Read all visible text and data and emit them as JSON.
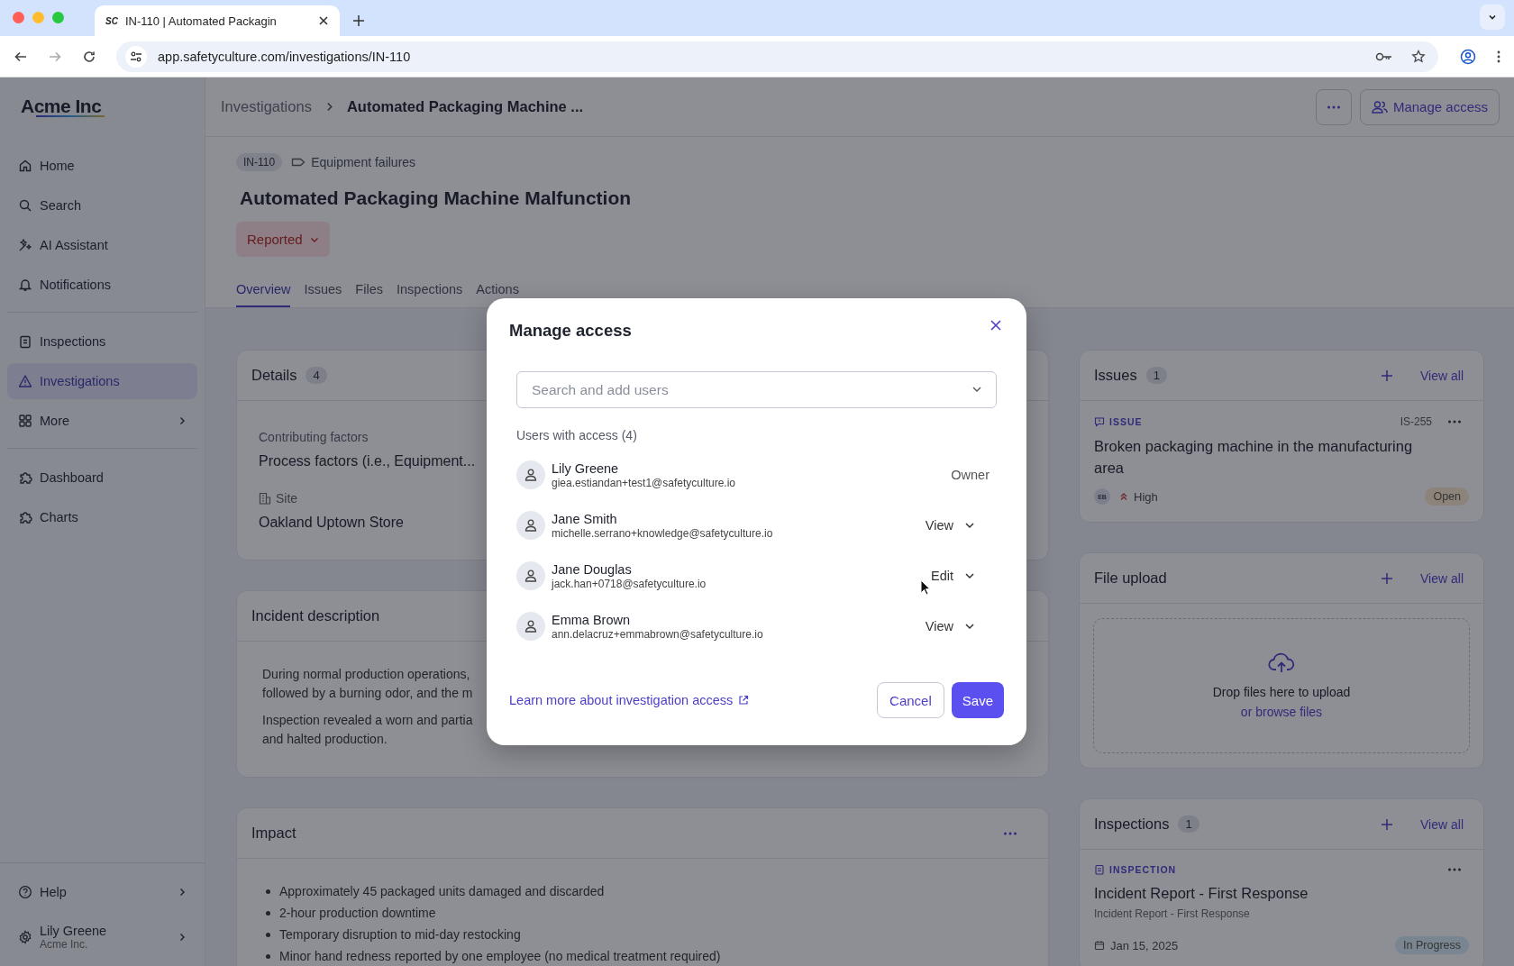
{
  "browser": {
    "favicon": "SC",
    "tab_title": "IN-110 | Automated Packagin",
    "url": "app.safetyculture.com/investigations/IN-110"
  },
  "sidebar": {
    "logo": "Acme Inc",
    "groups": [
      [
        {
          "label": "Home",
          "selected": false,
          "expandable": false
        },
        {
          "label": "Search",
          "selected": false,
          "expandable": false
        },
        {
          "label": "AI Assistant",
          "selected": false,
          "expandable": false
        },
        {
          "label": "Notifications",
          "selected": false,
          "expandable": false
        }
      ],
      [
        {
          "label": "Inspections",
          "selected": false,
          "expandable": false
        },
        {
          "label": "Investigations",
          "selected": true,
          "expandable": false
        },
        {
          "label": "More",
          "selected": false,
          "expandable": true
        }
      ],
      [
        {
          "label": "Dashboard",
          "selected": false,
          "expandable": false
        },
        {
          "label": "Charts",
          "selected": false,
          "expandable": false
        }
      ]
    ],
    "help": "Help",
    "user": {
      "name": "Lily Greene",
      "org": "Acme Inc."
    }
  },
  "header": {
    "breadcrumb": [
      "Investigations",
      "Automated Packaging Machine ..."
    ],
    "manage_access": "Manage access"
  },
  "investigation": {
    "id": "IN-110",
    "category": "Equipment failures",
    "title": "Automated Packaging Machine Malfunction",
    "status": "Reported"
  },
  "tabs": [
    {
      "label": "Overview",
      "selected": true
    },
    {
      "label": "Issues",
      "selected": false
    },
    {
      "label": "Files",
      "selected": false
    },
    {
      "label": "Inspections",
      "selected": false
    },
    {
      "label": "Actions",
      "selected": false
    }
  ],
  "details": {
    "title": "Details",
    "count": "4",
    "fields": [
      {
        "kind": "plain",
        "label": "Contributing factors",
        "value": "Process factors (i.e., Equipment..."
      },
      {
        "kind": "site",
        "label": "Site",
        "value": "Oakland Uptown Store"
      }
    ]
  },
  "incident": {
    "title": "Incident description",
    "paragraphs": [
      [
        "During normal production operations,",
        "followed by a burning odor, and the m"
      ],
      [
        "Inspection revealed a worn and partia",
        "and halted production."
      ]
    ]
  },
  "impact": {
    "title": "Impact",
    "bullets": [
      "Approximately 45 packaged units damaged and discarded",
      "2-hour production downtime",
      "Temporary disruption to mid-day restocking",
      "Minor hand redness reported by one employee (no medical treatment required)"
    ]
  },
  "issues": {
    "title": "Issues",
    "count": "1",
    "view_all": "View all",
    "item": {
      "type_label": "ISSUE",
      "ref": "IS-255",
      "title": "Broken packaging machine in the manufacturing area",
      "assignee": "EB",
      "priority": "High",
      "status": {
        "label": "Open",
        "kind": "open"
      }
    }
  },
  "file_upload": {
    "title": "File upload",
    "view_all": "View all",
    "drop_text": "Drop files here to upload",
    "browse": "or browse files"
  },
  "inspections": {
    "title": "Inspections",
    "count": "1",
    "view_all": "View all",
    "item": {
      "type_label": "INSPECTION",
      "title": "Incident Report - First Response",
      "subtitle": "Incident Report - First Response",
      "date": "Jan 15, 2025",
      "status": {
        "label": "In Progress",
        "kind": "in_progress"
      }
    }
  },
  "modal": {
    "title": "Manage access",
    "search_placeholder": "Search and add users",
    "section": "Users with access (4)",
    "users": [
      {
        "name": "Lily Greene",
        "email": "giea.estiandan+test1@safetyculture.io",
        "role": "Owner",
        "kind": "owner"
      },
      {
        "name": "Jane Smith",
        "email": "michelle.serrano+knowledge@safetyculture.io",
        "role": "View",
        "kind": "select"
      },
      {
        "name": "Jane Douglas",
        "email": "jack.han+0718@safetyculture.io",
        "role": "Edit",
        "kind": "select"
      },
      {
        "name": "Emma Brown",
        "email": "ann.delacruz+emmabrown@safetyculture.io",
        "role": "View",
        "kind": "select"
      }
    ],
    "link": "Learn more about investigation access",
    "cancel": "Cancel",
    "save": "Save"
  }
}
